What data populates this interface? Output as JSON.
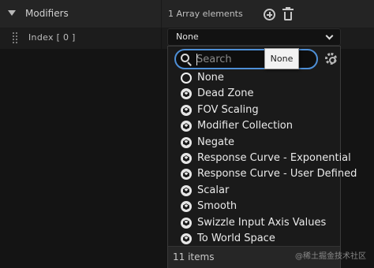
{
  "header": {
    "title": "Modifiers",
    "array_count": "1 Array elements",
    "add_icon": "add-icon",
    "delete_icon": "trash-icon"
  },
  "index_row": {
    "label": "Index [ 0 ]",
    "selected_value": "None"
  },
  "dropdown": {
    "search_placeholder": "Search",
    "search_value": "",
    "tooltip": "None",
    "items": [
      {
        "label": "None",
        "icon": "empty-circle-icon"
      },
      {
        "label": "Dead Zone",
        "icon": "class-icon"
      },
      {
        "label": "FOV Scaling",
        "icon": "class-icon"
      },
      {
        "label": "Modifier Collection",
        "icon": "class-icon"
      },
      {
        "label": "Negate",
        "icon": "class-icon"
      },
      {
        "label": "Response Curve - Exponential",
        "icon": "class-icon"
      },
      {
        "label": "Response Curve - User Defined",
        "icon": "class-icon"
      },
      {
        "label": "Scalar",
        "icon": "class-icon"
      },
      {
        "label": "Smooth",
        "icon": "class-icon"
      },
      {
        "label": "Swizzle Input Axis Values",
        "icon": "class-icon"
      },
      {
        "label": "To World Space",
        "icon": "class-icon"
      }
    ],
    "item_count": "11 items"
  },
  "watermark": "@稀土掘金技术社区",
  "colors": {
    "accent": "#4e8fd6",
    "panel": "#242424",
    "background": "#141414"
  }
}
